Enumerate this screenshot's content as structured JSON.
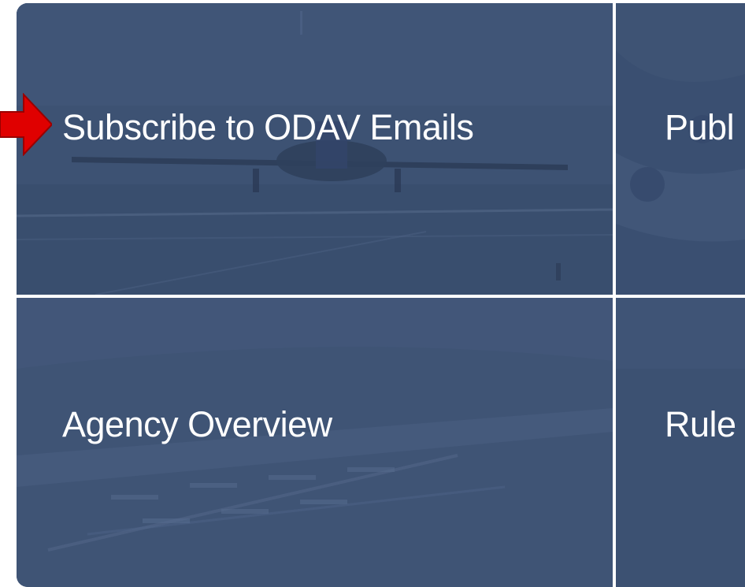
{
  "tiles": {
    "subscribe": {
      "label": "Subscribe to ODAV Emails"
    },
    "publications": {
      "label": "Publ"
    },
    "agency_overview": {
      "label": "Agency Overview"
    },
    "rules": {
      "label": "Rule"
    }
  },
  "annotation": {
    "arrow_color": "#e00000"
  },
  "colors": {
    "tile_overlay": "#3f5475",
    "divider": "#ffffff",
    "label_text": "#ffffff"
  }
}
